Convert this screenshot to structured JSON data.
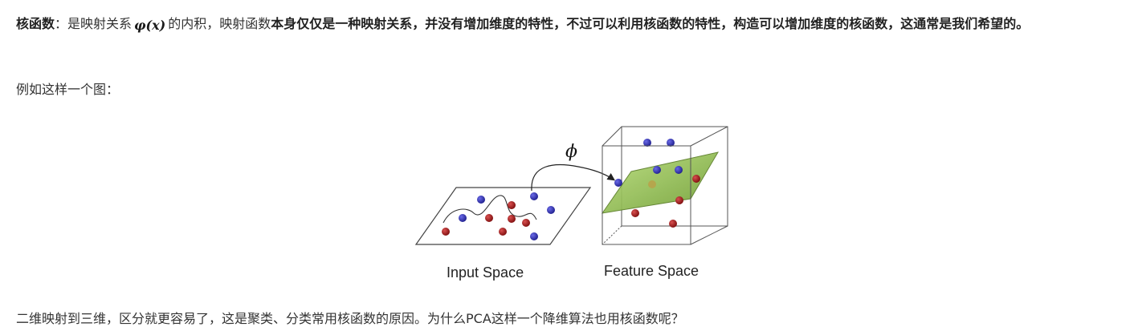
{
  "para1": {
    "term": "核函数",
    "text_a": "：是映射关系",
    "formula": "φ(x)",
    "text_b": "的内积，映射函数",
    "bold": "本身仅仅是一种映射关系，并没有增加维度的特性，不过可以利用核函数的特性，构造可以增加维度的核函数，这通常是我们希望的。"
  },
  "para2": "例如这样一个图：",
  "figure": {
    "phi_symbol": "ϕ",
    "input_label": "Input Space",
    "feature_label": "Feature Space",
    "colors": {
      "blue_point": "#2b2bb0",
      "red_point": "#aa1a1a",
      "plane": "#8fc24a"
    }
  },
  "para3": "二维映射到三维，区分就更容易了，这是聚类、分类常用核函数的原因。为什么PCA这样一个降维算法也用核函数呢？"
}
